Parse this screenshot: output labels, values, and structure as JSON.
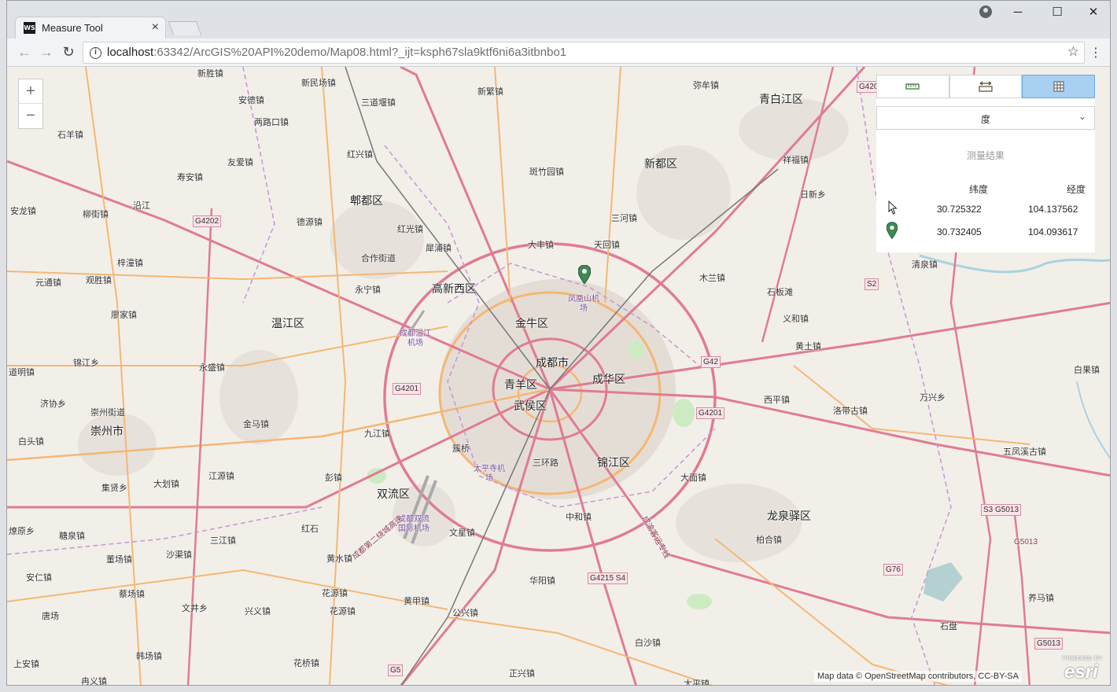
{
  "browser": {
    "tab_title": "Measure Tool",
    "favicon_text": "WS",
    "tab_close": "×",
    "url_host": "localhost",
    "url_rest": ":63342/ArcGIS%20API%20demo/Map08.html?_ijt=ksph67sla9ktf6ni6a3itbnbo1",
    "window_controls": {
      "minimize": "─",
      "maximize": "☐",
      "close": "✕"
    },
    "nav": {
      "back": "←",
      "forward": "→",
      "reload": "↻"
    },
    "star": "☆",
    "menu": "⋮",
    "info": "i"
  },
  "map": {
    "zoom_in": "+",
    "zoom_out": "−",
    "attribution": "Map data © OpenStreetMap contributors, CC-BY-SA",
    "esri_logo": "esri",
    "esri_powered": "POWERED BY",
    "places": [
      {
        "label": "成都市",
        "big": true
      },
      {
        "label": "金牛区",
        "big": true
      },
      {
        "label": "青羊区",
        "big": true
      },
      {
        "label": "成华区",
        "big": true
      },
      {
        "label": "武侯区",
        "big": true
      },
      {
        "label": "锦江区",
        "big": true
      },
      {
        "label": "高新西区",
        "big": true
      },
      {
        "label": "温江区",
        "big": true
      },
      {
        "label": "郫都区",
        "big": true
      },
      {
        "label": "新都区",
        "big": true
      },
      {
        "label": "青白江区",
        "big": true
      },
      {
        "label": "双流区",
        "big": true
      },
      {
        "label": "龙泉驿区",
        "big": true
      },
      {
        "label": "崇州市",
        "big": true
      },
      {
        "label": "新胜镇"
      },
      {
        "label": "新民场镇"
      },
      {
        "label": "安德镇"
      },
      {
        "label": "两路口镇"
      },
      {
        "label": "三道堰镇"
      },
      {
        "label": "新繁镇"
      },
      {
        "label": "弥牟镇"
      },
      {
        "label": "石羊镇"
      },
      {
        "label": "红兴镇"
      },
      {
        "label": "友爱镇"
      },
      {
        "label": "斑竹园镇"
      },
      {
        "label": "寿安镇"
      },
      {
        "label": "祥福镇"
      },
      {
        "label": "日新乡"
      },
      {
        "label": "安龙镇"
      },
      {
        "label": "柳街镇"
      },
      {
        "label": "沿江"
      },
      {
        "label": "德源镇"
      },
      {
        "label": "红光镇"
      },
      {
        "label": "三河镇"
      },
      {
        "label": "犀浦镇"
      },
      {
        "label": "大丰镇"
      },
      {
        "label": "天回镇"
      },
      {
        "label": "合作街道"
      },
      {
        "label": "梓潼镇"
      },
      {
        "label": "元通镇"
      },
      {
        "label": "观胜镇"
      },
      {
        "label": "永宁镇"
      },
      {
        "label": "木兰镇"
      },
      {
        "label": "清泉镇"
      },
      {
        "label": "石板滩"
      },
      {
        "label": "廖家镇"
      },
      {
        "label": "义和镇"
      },
      {
        "label": "黄土镇"
      },
      {
        "label": "锦江乡"
      },
      {
        "label": "永盛镇"
      },
      {
        "label": "道明镇"
      },
      {
        "label": "济协乡"
      },
      {
        "label": "崇州街道"
      },
      {
        "label": "西平镇"
      },
      {
        "label": "万兴乡"
      },
      {
        "label": "洛带古镇"
      },
      {
        "label": "白头镇"
      },
      {
        "label": "金马镇"
      },
      {
        "label": "九江镇"
      },
      {
        "label": "簇桥"
      },
      {
        "label": "三环路"
      },
      {
        "label": "五凤溪古镇"
      },
      {
        "label": "集贤乡"
      },
      {
        "label": "大划镇"
      },
      {
        "label": "江源镇"
      },
      {
        "label": "彭镇"
      },
      {
        "label": "大面镇"
      },
      {
        "label": "燎原乡"
      },
      {
        "label": "中和镇"
      },
      {
        "label": "红石"
      },
      {
        "label": "文星镇"
      },
      {
        "label": "糖泉镇"
      },
      {
        "label": "三江镇"
      },
      {
        "label": "柏合镇"
      },
      {
        "label": "董场镇"
      },
      {
        "label": "沙渠镇"
      },
      {
        "label": "黄水镇"
      },
      {
        "label": "安仁镇"
      },
      {
        "label": "华阳镇"
      },
      {
        "label": "蔡场镇"
      },
      {
        "label": "花源镇"
      },
      {
        "label": "养马镇"
      },
      {
        "label": "唐场"
      },
      {
        "label": "文井乡"
      },
      {
        "label": "兴义镇"
      },
      {
        "label": "黄甲镇"
      },
      {
        "label": "花源镇"
      },
      {
        "label": "公兴镇"
      },
      {
        "label": "石盘"
      },
      {
        "label": "白沙镇"
      },
      {
        "label": "韩场镇"
      },
      {
        "label": "上安镇"
      },
      {
        "label": "花桥镇"
      },
      {
        "label": "冉义镇"
      },
      {
        "label": "正兴镇"
      },
      {
        "label": "太平镇"
      },
      {
        "label": "白果镇"
      }
    ],
    "airports": [
      {
        "label": "凤凰山机场"
      },
      {
        "label": "成都温江机场"
      },
      {
        "label": "太平寺机场"
      },
      {
        "label": "成都双流国际机场"
      }
    ],
    "shields": [
      {
        "label": "G4202"
      },
      {
        "label": "G4201"
      },
      {
        "label": "G42"
      },
      {
        "label": "G4201"
      },
      {
        "label": "S2"
      },
      {
        "label": "S3 G5013"
      },
      {
        "label": "G4215 S4"
      },
      {
        "label": "G76"
      },
      {
        "label": "G5013"
      },
      {
        "label": "G5"
      },
      {
        "label": "G420"
      }
    ],
    "road_labels": [
      {
        "label": "G5013"
      },
      {
        "label": "成都第二绕城高速"
      },
      {
        "label": "成渝客运专线"
      }
    ]
  },
  "measure_panel": {
    "tools": [
      {
        "name": "distance-tool",
        "active": false
      },
      {
        "name": "area-tool",
        "active": false
      },
      {
        "name": "location-tool",
        "active": true
      }
    ],
    "unit": "度",
    "unit_chevron": "⌄",
    "result_title": "测量结果",
    "col_lat": "纬度",
    "col_lon": "经度",
    "rows": [
      {
        "marker": "cursor",
        "lat": "30.725322",
        "lon": "104.137562"
      },
      {
        "marker": "pin",
        "lat": "30.732405",
        "lon": "104.093617"
      }
    ]
  },
  "colors": {
    "highway": "#e07b93",
    "trunk": "#f5b773",
    "boundary": "#c596d4",
    "panel_active": "#a7d0f2",
    "pin_green": "#3d8a52"
  }
}
